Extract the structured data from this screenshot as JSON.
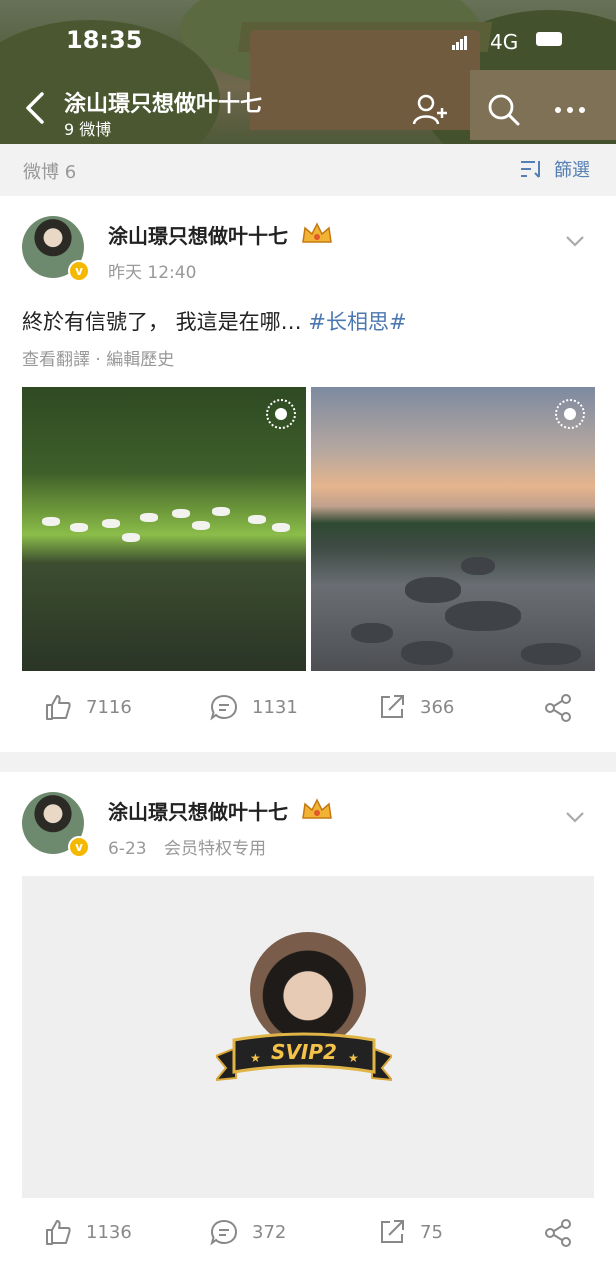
{
  "status_bar": {
    "time": "18:35",
    "network": "4G"
  },
  "header": {
    "title": "涂山璟只想做叶十七",
    "subtitle": "9 微博"
  },
  "filter_bar": {
    "count_label": "微博 6",
    "filter_label": "篩選"
  },
  "posts": [
    {
      "author": "涂山璟只想做叶十七",
      "time": "昨天 12:40",
      "text": "終於有信號了， 我這是在哪…",
      "hashtag": "#长相思#",
      "links": "查看翻譯 · 編輯歷史",
      "likes": "7116",
      "comments": "1131",
      "reposts": "366"
    },
    {
      "author": "涂山璟只想做叶十七",
      "time": "6-23",
      "source": "会员特权专用",
      "badge_text": "SVIP2",
      "likes": "1136",
      "comments": "372",
      "reposts": "75"
    }
  ],
  "colors": {
    "link_blue": "#4c78b2",
    "vip_gold": "#f5b800",
    "gray_text": "#999999"
  }
}
